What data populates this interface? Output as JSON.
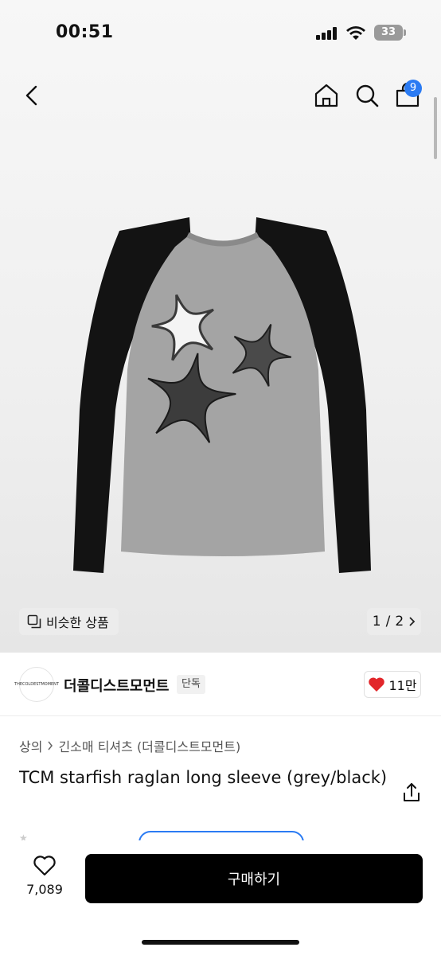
{
  "status_bar": {
    "time": "00:51",
    "battery": "33"
  },
  "header": {
    "cart_count": "9"
  },
  "gallery": {
    "similar_label": "비슷한 상품",
    "page_current": "1",
    "page_sep": "/",
    "page_total": "2"
  },
  "brand": {
    "logo_text": "THECOLDESTMOMENT",
    "name": "더콜디스트모먼트",
    "tag": "단독",
    "likes": "11만"
  },
  "product": {
    "breadcrumb": [
      "상의",
      "긴소매 티셔츠 (더콜디스트모먼트)"
    ],
    "title": "TCM starfish raglan long sleeve (grey/black)"
  },
  "bottom": {
    "wish_count": "7,089",
    "buy_label": "구매하기"
  },
  "colors": {
    "accent": "#2b7bf3",
    "like": "#e2262a",
    "buy_bg": "#000000"
  }
}
